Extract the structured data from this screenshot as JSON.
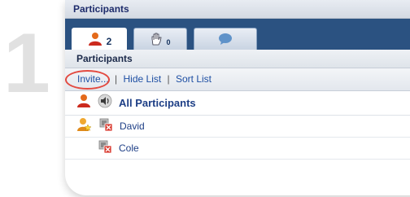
{
  "step": {
    "number": "1"
  },
  "window": {
    "title": "Participants"
  },
  "tabs": [
    {
      "icon": "participants-icon",
      "count": "2",
      "active": true
    },
    {
      "icon": "raised-hand-icon",
      "count": "0",
      "active": false
    },
    {
      "icon": "chat-bubble-icon",
      "count": "",
      "active": false
    }
  ],
  "panel": {
    "header": "Participants"
  },
  "toolbar": {
    "invite": "Invite...",
    "separator": "|",
    "hide_list": "Hide List",
    "sort_list": "Sort List"
  },
  "all_participants": {
    "label": "All Participants",
    "icons": [
      "participant-icon",
      "speaker-icon"
    ]
  },
  "participants": [
    {
      "name": "David",
      "icons": [
        "presenter-icon",
        "webcam-muted-icon"
      ]
    },
    {
      "name": "Cole",
      "icons": [
        "webcam-muted-icon"
      ]
    }
  ],
  "colors": {
    "tab_bar": "#2b5281",
    "link": "#1e4fa3",
    "name": "#1e3f86",
    "highlight": "#e34a40"
  }
}
